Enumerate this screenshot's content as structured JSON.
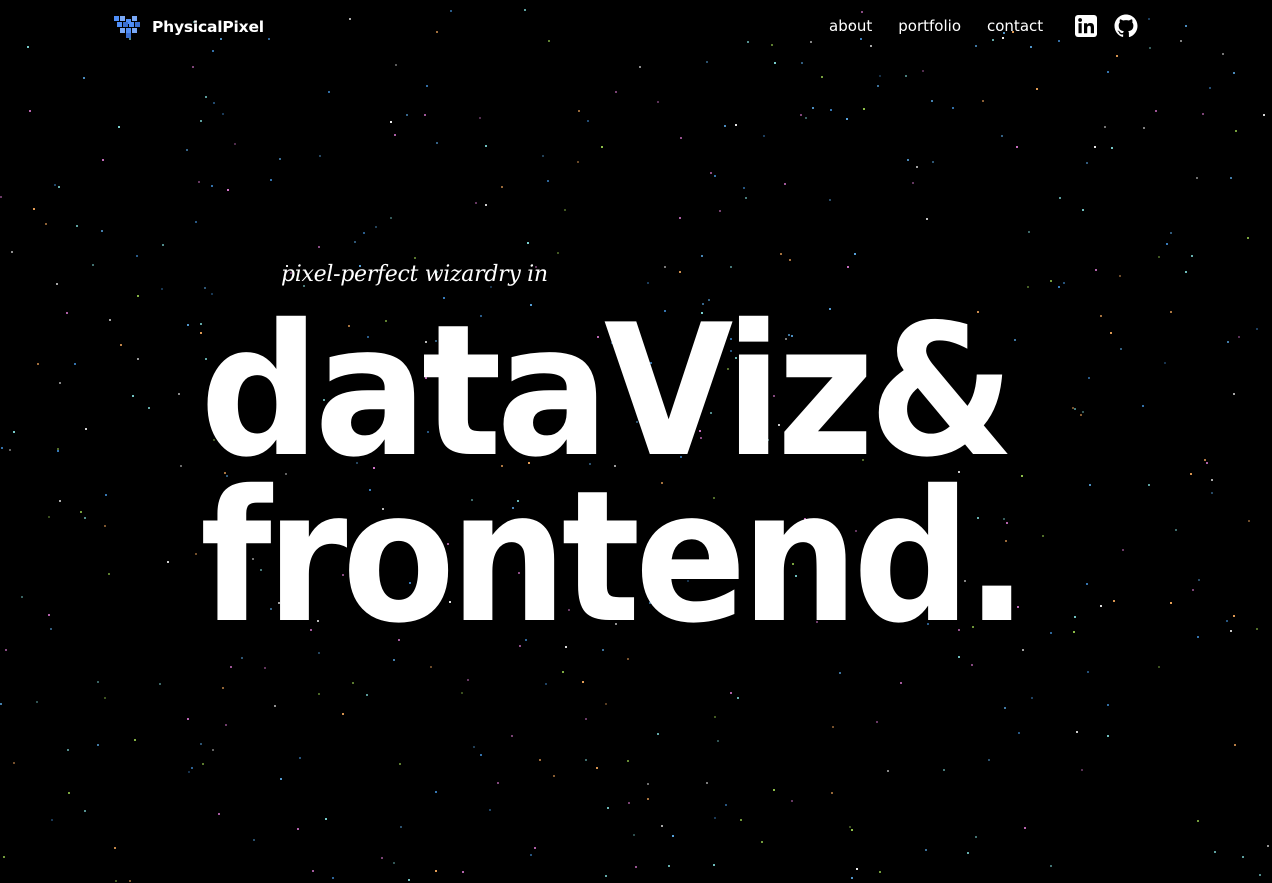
{
  "header": {
    "brand": "PhysicalPixel",
    "brand_color": "#4f8ef7",
    "nav": [
      {
        "label": "about"
      },
      {
        "label": "portfolio"
      },
      {
        "label": "contact"
      }
    ],
    "social": [
      {
        "icon": "linkedin-icon",
        "label": "LinkedIn"
      },
      {
        "icon": "github-icon",
        "label": "GitHub"
      }
    ]
  },
  "hero": {
    "tagline": "pixel-perfect wizardry in",
    "headline_line1": "dataViz&",
    "headline_line2": "frontend."
  },
  "colors": {
    "background": "#000000",
    "text": "#ffffff",
    "star_colors": [
      "#3b82c4",
      "#f2a65a",
      "#7fdbda",
      "#e07ad6",
      "#9ad04f",
      "#ffffff",
      "#5aa9e6"
    ]
  }
}
